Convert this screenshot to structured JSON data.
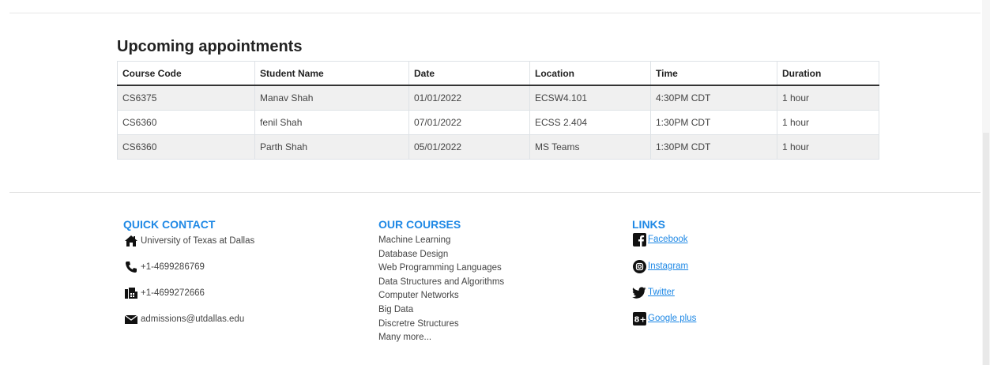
{
  "appointments": {
    "title": "Upcoming appointments",
    "columns": [
      "Course Code",
      "Student Name",
      "Date",
      "Location",
      "Time",
      "Duration"
    ],
    "rows": [
      [
        "CS6375",
        "Manav Shah",
        "01/01/2022",
        "ECSW4.101",
        "4:30PM CDT",
        "1 hour"
      ],
      [
        "CS6360",
        "fenil Shah",
        "07/01/2022",
        "ECSS 2.404",
        "1:30PM CDT",
        "1 hour"
      ],
      [
        "CS6360",
        "Parth Shah",
        "05/01/2022",
        "MS Teams",
        "1:30PM CDT",
        "1 hour"
      ]
    ]
  },
  "footer": {
    "contact": {
      "heading": "QUICK CONTACT",
      "address": "University of Texas at Dallas",
      "phone": "+1-4699286769",
      "fax": "+1-4699272666",
      "email": "admissions@utdallas.edu"
    },
    "courses": {
      "heading": "OUR COURSES",
      "items": [
        "Machine Learning",
        "Database Design",
        "Web Programming Languages",
        "Data Structures and Algorithms",
        "Computer Networks",
        "Big Data",
        "Discretre Structures",
        "Many more..."
      ]
    },
    "links": {
      "heading": "LINKS",
      "facebook": "Facebook",
      "instagram": "Instagram",
      "twitter": "Twitter",
      "google": "Google plus"
    }
  },
  "colors": {
    "accent": "#1e88e5",
    "stripe": "#f0f0f0"
  }
}
